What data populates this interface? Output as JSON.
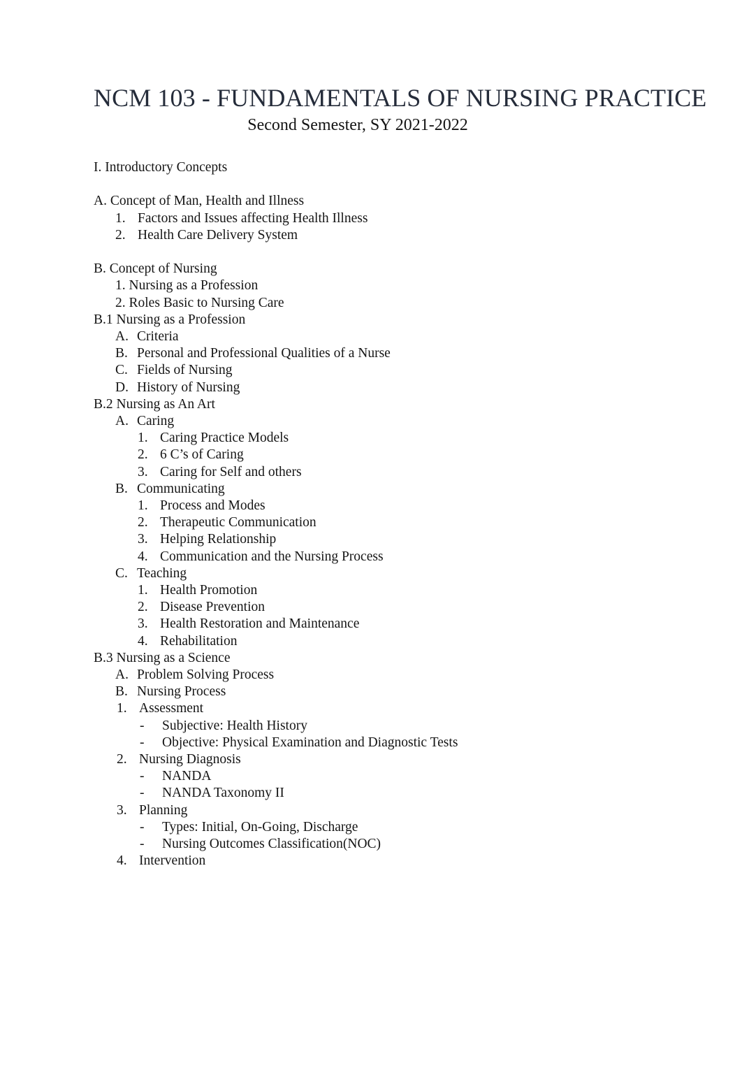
{
  "document": {
    "title": "NCM 103 - FUNDAMENTALS OF NURSING PRACTICE",
    "subtitle": "Second Semester, SY 2021-2022",
    "title_color": "#252c3a",
    "body_color": "#151515",
    "background_color": "#ffffff"
  },
  "outline": {
    "section_heading": "I. Introductory Concepts",
    "part_a": {
      "heading": "A. Concept of Man, Health and Illness",
      "items": [
        {
          "marker": "1.",
          "text": "Factors and Issues affecting Health Illness"
        },
        {
          "marker": "2.",
          "text": "Health Care Delivery System"
        }
      ]
    },
    "part_b": {
      "heading": "B. Concept of Nursing",
      "items": [
        {
          "marker": "1.",
          "text": " Nursing as a Profession"
        },
        {
          "marker": "2.",
          "text": " Roles Basic to Nursing Care"
        }
      ]
    },
    "part_b1": {
      "heading": "B.1 Nursing as a Profession",
      "items": [
        {
          "marker": "A.",
          "text": "Criteria"
        },
        {
          "marker": "B.",
          "text": "Personal and Professional Qualities of a Nurse"
        },
        {
          "marker": "C.",
          "text": "Fields of Nursing"
        },
        {
          "marker": "D.",
          "text": "History of Nursing"
        }
      ]
    },
    "part_b2": {
      "heading": "B.2 Nursing as An Art",
      "groups": [
        {
          "marker": "A.",
          "text": "Caring",
          "items": [
            {
              "marker": "1.",
              "text": "Caring Practice Models"
            },
            {
              "marker": "2.",
              "text": "6 C’s of Caring"
            },
            {
              "marker": "3.",
              "text": "Caring for Self and others"
            }
          ]
        },
        {
          "marker": "B.",
          "text": "Communicating",
          "items": [
            {
              "marker": "1.",
              "text": "Process and Modes"
            },
            {
              "marker": "2.",
              "text": "Therapeutic Communication"
            },
            {
              "marker": "3.",
              "text": "Helping Relationship"
            },
            {
              "marker": "4.",
              "text": "Communication and the Nursing Process"
            }
          ]
        },
        {
          "marker": "C.",
          "text": "Teaching",
          "items": [
            {
              "marker": "1.",
              "text": "Health Promotion"
            },
            {
              "marker": "2.",
              "text": "Disease Prevention"
            },
            {
              "marker": "3.",
              "text": "Health Restoration and Maintenance"
            },
            {
              "marker": "4.",
              "text": "Rehabilitation"
            }
          ]
        }
      ]
    },
    "part_b3": {
      "heading": "B.3 Nursing as a Science",
      "items": [
        {
          "marker": "A.",
          "text": "Problem Solving Process"
        },
        {
          "marker": "B.",
          "text": "Nursing Process"
        }
      ],
      "process_steps": [
        {
          "marker": "1.",
          "text": "Assessment",
          "bullets": [
            {
              "marker": "-",
              "text": "Subjective: Health History"
            },
            {
              "marker": "-",
              "text": "Objective: Physical Examination and Diagnostic Tests"
            }
          ]
        },
        {
          "marker": "2.",
          "text": "Nursing Diagnosis",
          "bullets": [
            {
              "marker": "-",
              "text": "NANDA"
            },
            {
              "marker": "-",
              "text": "NANDA Taxonomy II"
            }
          ]
        },
        {
          "marker": "3.",
          "text": "Planning",
          "bullets": [
            {
              "marker": "-",
              "text": "Types: Initial, On-Going, Discharge"
            },
            {
              "marker": "-",
              "text": "Nursing Outcomes Classification(NOC)"
            }
          ]
        },
        {
          "marker": "4.",
          "text": "Intervention",
          "bullets": []
        }
      ]
    }
  }
}
